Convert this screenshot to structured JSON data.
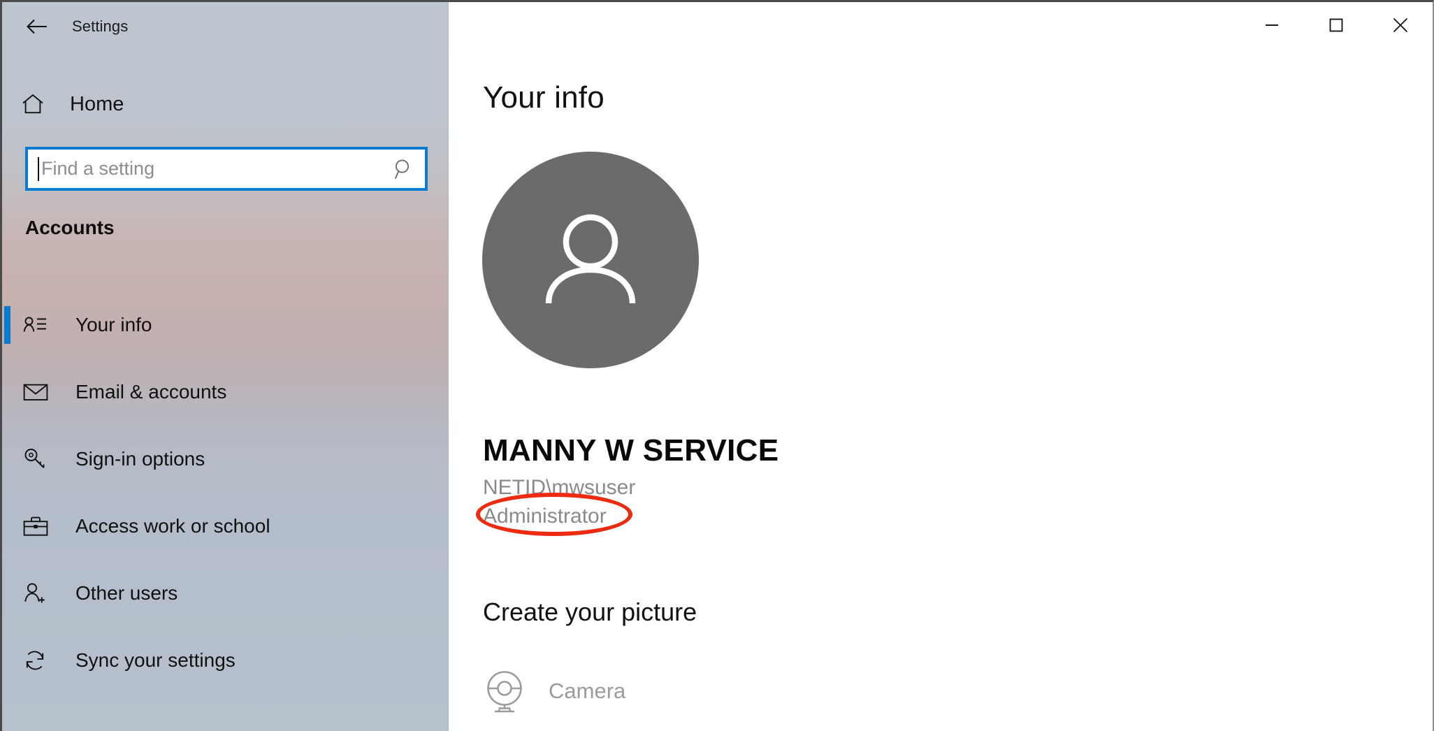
{
  "window": {
    "title": "Settings",
    "controls": [
      {
        "name": "minimize",
        "glyph": "minimize-icon"
      },
      {
        "name": "maximize",
        "glyph": "maximize-icon"
      },
      {
        "name": "close",
        "glyph": "close-icon"
      }
    ]
  },
  "sidebar": {
    "back_label": "back-arrow-icon",
    "home": {
      "label": "Home",
      "icon": "home-icon"
    },
    "search": {
      "placeholder": "Find a setting",
      "value": "",
      "icon": "search-icon"
    },
    "section_header": "Accounts",
    "items": [
      {
        "label": "Your info",
        "icon": "contact-card-icon",
        "selected": true
      },
      {
        "label": "Email & accounts",
        "icon": "envelope-icon",
        "selected": false
      },
      {
        "label": "Sign-in options",
        "icon": "key-icon",
        "selected": false
      },
      {
        "label": "Access work or school",
        "icon": "briefcase-icon",
        "selected": false
      },
      {
        "label": "Other users",
        "icon": "person-add-icon",
        "selected": false
      },
      {
        "label": "Sync your settings",
        "icon": "sync-icon",
        "selected": false
      }
    ]
  },
  "content": {
    "page_title": "Your info",
    "avatar_icon": "person-avatar-icon",
    "display_name": "MANNY W SERVICE",
    "account_id": "NETID\\mwsuser",
    "account_type": "Administrator",
    "subsection_title": "Create your picture",
    "camera": {
      "label": "Camera",
      "icon": "webcam-icon"
    }
  },
  "annotation": {
    "shape": "ellipse",
    "color": "#ee2b11",
    "target": "Administrator"
  },
  "colors": {
    "accent": "#0a7bd1",
    "annotation": "#ee2b11",
    "avatar_bg": "#6b6b6b",
    "muted_text": "#8a8a8a"
  }
}
